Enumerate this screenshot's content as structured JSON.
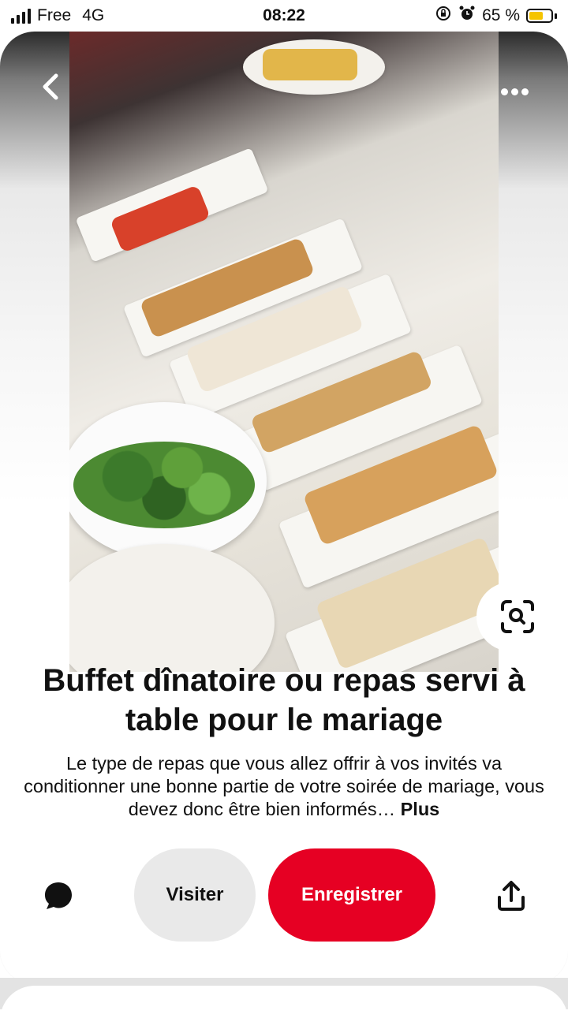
{
  "status_bar": {
    "carrier": "Free",
    "network": "4G",
    "time": "08:22",
    "battery_percent": "65 %",
    "battery_level": 0.65,
    "battery_color": "#f5c400",
    "icons": [
      "signal-icon",
      "rotation-lock-icon",
      "alarm-icon",
      "battery-icon"
    ]
  },
  "pin": {
    "image_alt": "buffet-photo",
    "title": "Buffet dînatoire ou repas servi à table pour le mariage",
    "description": "Le type de repas que vous allez offrir à vos invités va conditionner une bonne partie de votre soirée de mariage, vous devez donc être bien informés…",
    "more_label": "Plus"
  },
  "actions": {
    "visit_label": "Visiter",
    "save_label": "Enregistrer",
    "save_color": "#e60023",
    "icons": [
      "back-icon",
      "more-icon",
      "visual-search-icon",
      "comment-icon",
      "share-icon"
    ]
  }
}
